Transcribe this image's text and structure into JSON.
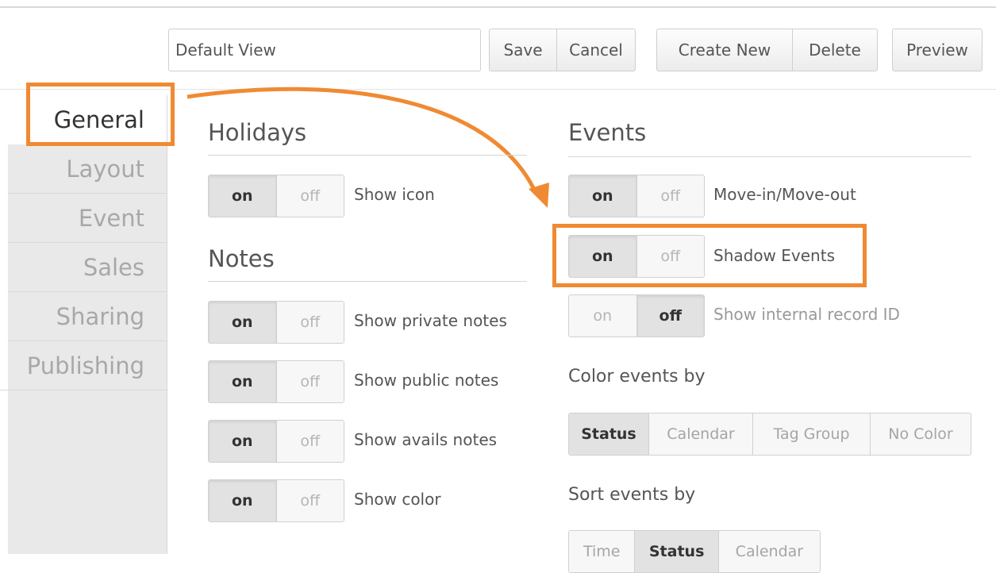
{
  "toolbar": {
    "view_name_value": "Default View",
    "save_label": "Save",
    "cancel_label": "Cancel",
    "create_new_label": "Create New",
    "delete_label": "Delete",
    "preview_label": "Preview"
  },
  "sidebar": {
    "items": [
      {
        "label": "General",
        "active": true
      },
      {
        "label": "Layout"
      },
      {
        "label": "Event"
      },
      {
        "label": "Sales"
      },
      {
        "label": "Sharing"
      },
      {
        "label": "Publishing"
      }
    ]
  },
  "holidays": {
    "title": "Holidays",
    "show_icon": {
      "label": "Show icon",
      "on": "on",
      "off": "off",
      "state": "on"
    }
  },
  "notes": {
    "title": "Notes",
    "private": {
      "label": "Show private notes",
      "on": "on",
      "off": "off",
      "state": "on"
    },
    "public": {
      "label": "Show public notes",
      "on": "on",
      "off": "off",
      "state": "on"
    },
    "avails": {
      "label": "Show avails notes",
      "on": "on",
      "off": "off",
      "state": "on"
    },
    "color": {
      "label": "Show color",
      "on": "on",
      "off": "off",
      "state": "on"
    }
  },
  "events": {
    "title": "Events",
    "move_in_out": {
      "label": "Move-in/Move-out",
      "on": "on",
      "off": "off",
      "state": "on"
    },
    "shadow": {
      "label": "Shadow Events",
      "on": "on",
      "off": "off",
      "state": "on"
    },
    "internal_id": {
      "label": "Show internal record ID",
      "on": "on",
      "off": "off",
      "state": "off"
    },
    "color_by": {
      "label": "Color events by",
      "options": [
        "Status",
        "Calendar",
        "Tag Group",
        "No Color"
      ],
      "selected": "Status"
    },
    "sort_by": {
      "label": "Sort events by",
      "options": [
        "Time",
        "Status",
        "Calendar"
      ],
      "selected": "Status"
    }
  },
  "colors": {
    "annotation": "#f08a32"
  }
}
